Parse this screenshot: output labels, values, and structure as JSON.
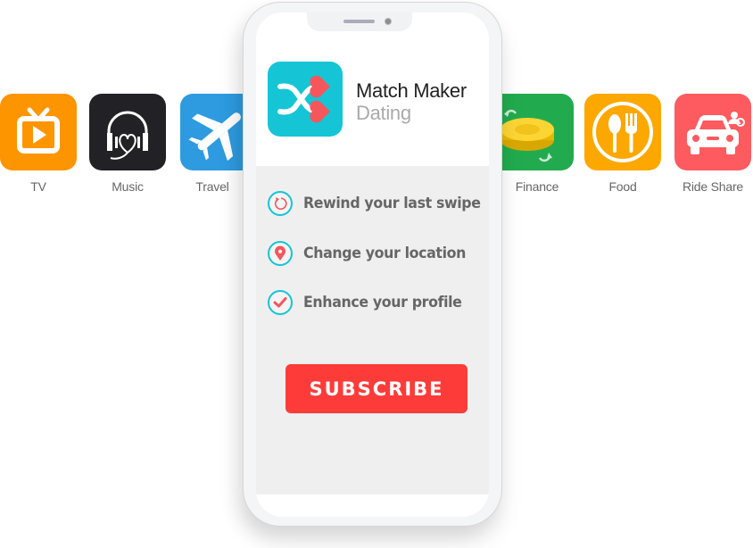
{
  "apps_left": [
    {
      "id": "tv",
      "label": "TV",
      "icon": "tv-icon",
      "color": "#fd9500"
    },
    {
      "id": "music",
      "label": "Music",
      "icon": "headphones-heart-icon",
      "color": "#222226"
    },
    {
      "id": "travel",
      "label": "Travel",
      "icon": "airplane-icon",
      "color": "#2e9be0"
    }
  ],
  "apps_right": [
    {
      "id": "finance",
      "label": "Finance",
      "icon": "coin-icon",
      "color": "#22ab4e"
    },
    {
      "id": "food",
      "label": "Food",
      "icon": "plate-spoon-fork-icon",
      "color": "#fda800"
    },
    {
      "id": "rideshare",
      "label": "Ride Share",
      "icon": "car-icon",
      "color": "#fd5b5f"
    }
  ],
  "phone": {
    "app": {
      "title": "Match Maker",
      "subtitle": "Dating",
      "icon": "shuffle-hearts-icon",
      "icon_color": "#15c5d5",
      "heart_color": "#f5565c"
    },
    "features": [
      {
        "label": "Rewind your last swipe",
        "icon": "rewind-icon"
      },
      {
        "label": "Change your location",
        "icon": "location-pin-icon"
      },
      {
        "label": "Enhance your profile",
        "icon": "checkmark-icon"
      }
    ],
    "subscribe_label": "SUBSCRIBE",
    "accent_color": "#fd3c3a"
  }
}
